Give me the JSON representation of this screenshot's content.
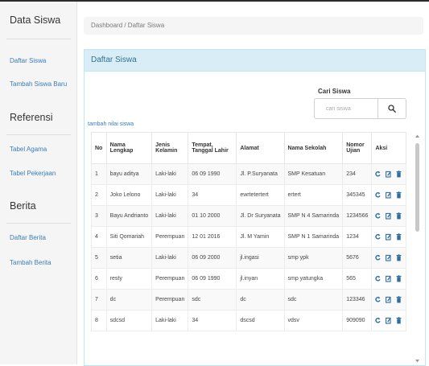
{
  "sidebar": {
    "title": "Data Siswa",
    "items": [
      {
        "label": "Daftar Siswa"
      },
      {
        "label": "Tambah Siswa Baru"
      }
    ],
    "referensi": {
      "title": "Referensi",
      "items": [
        {
          "label": "Tabel Agama"
        },
        {
          "label": "Tabel Pekerjaan"
        }
      ]
    },
    "berita": {
      "title": "Berita",
      "items": [
        {
          "label": "Daftar Berita"
        },
        {
          "label": "Tambah Berita"
        }
      ]
    }
  },
  "breadcrumb": "Dashboard / Daftar Siswa",
  "panel": {
    "title": "Daftar Siswa",
    "search_label": "Cari Siswa",
    "search_placeholder": "cari siswa",
    "add_link": "tambah nilai siswa"
  },
  "table": {
    "headers": [
      "No",
      "Nama Lengkap",
      "Jenis Kelamin",
      "Tempat, Tanggal Lahir",
      "Alamat",
      "Nama Sekolah",
      "Nomor Ujian",
      "Aksi"
    ],
    "rows": [
      [
        "1",
        "bayu aditya",
        "Laki-laki",
        "06 09 1990",
        "Jl. P.Suryanata",
        "SMP Kesatuan",
        "234"
      ],
      [
        "2",
        "Joko Lelono",
        "Laki-laki",
        "34",
        "ewrtetertert",
        "ertert",
        "345345"
      ],
      [
        "3",
        "Bayu Andrianto",
        "Laki-laki",
        "01 10 2000",
        "Jl. Dr Suryanata",
        "SMP N 4 Samarinda",
        "1234566"
      ],
      [
        "4",
        "Siti Qomariah",
        "Perempuan",
        "12 01 2016",
        "Jl. M Yamin",
        "SMP N 1 Samarinda",
        "1234"
      ],
      [
        "5",
        "setia",
        "Laki-laki",
        "06 09 2000",
        "jl.ingasi",
        "smp ypk",
        "5676"
      ],
      [
        "6",
        "resty",
        "Perempuan",
        "06 09 1990",
        "jl.inyan",
        "smp yatungka",
        "565"
      ],
      [
        "7",
        "dc",
        "Perempuan",
        "sdc",
        "dc",
        "sdc",
        "123346"
      ],
      [
        "8",
        "sdcsd",
        "Laki-laki",
        "34",
        "dscsd",
        "vdsv",
        "909090"
      ]
    ]
  },
  "colors": {
    "panel_heading_bg": "#d9edf7",
    "panel_heading_text": "#31708f",
    "link": "#3a7cb8",
    "action_icon": "#2e6da4"
  },
  "icons": {
    "search": "search-icon",
    "refresh": "refresh-icon",
    "edit": "edit-icon",
    "delete": "trash-icon"
  }
}
